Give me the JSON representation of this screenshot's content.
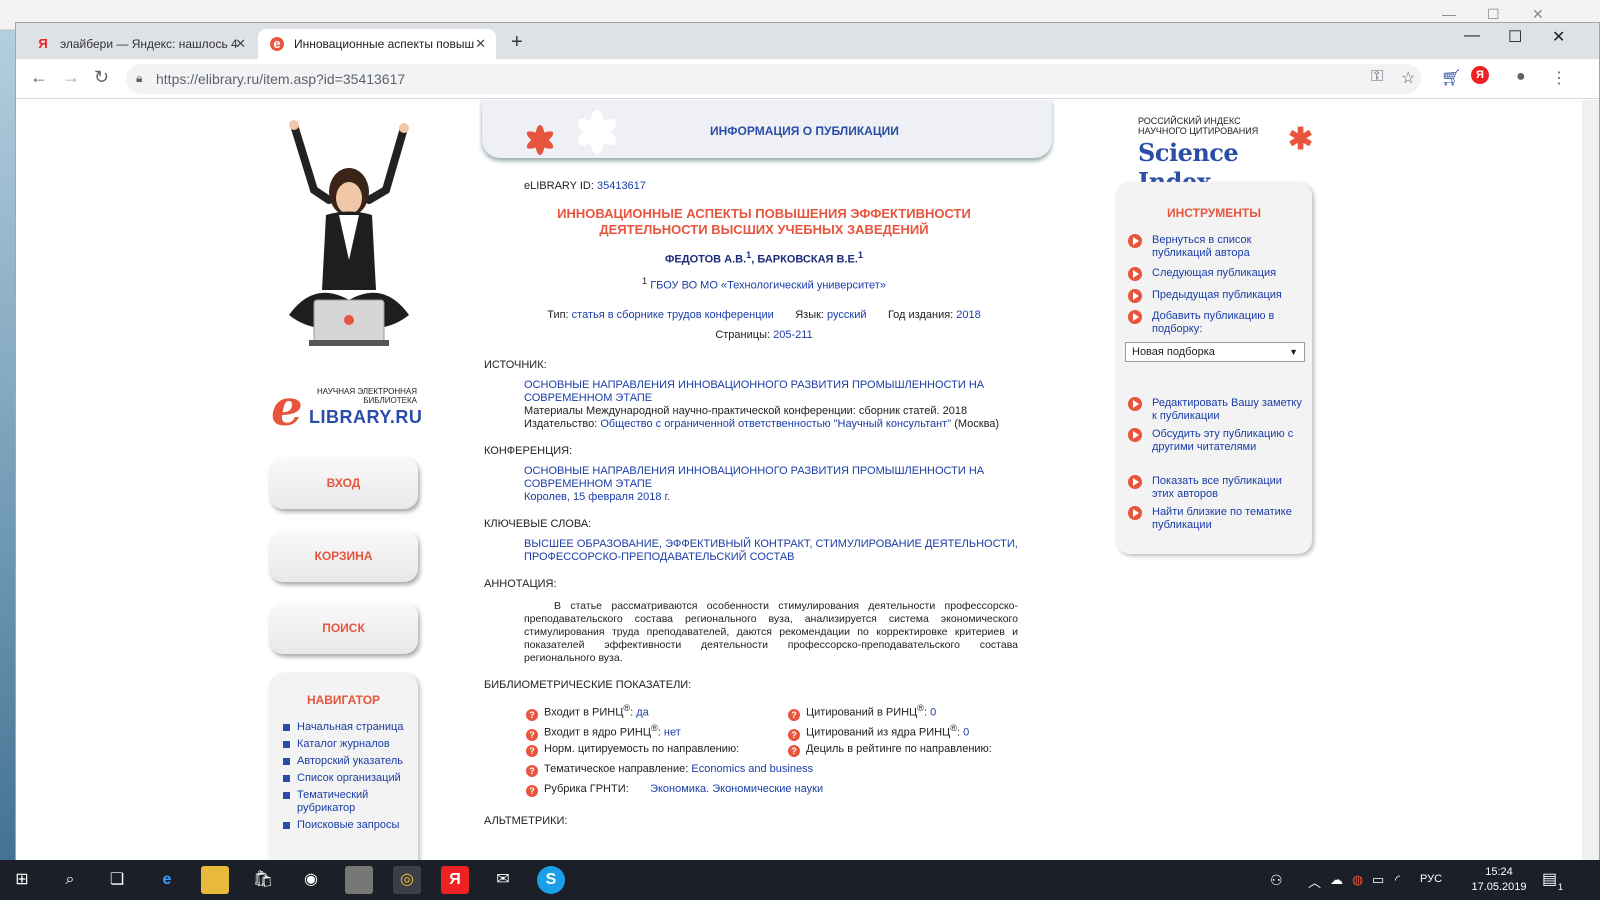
{
  "browser": {
    "tabs": [
      {
        "label": "элайбери — Яндекс: нашлось 4",
        "favicon": "Я",
        "active": false
      },
      {
        "label": "Инновационные аспекты повыш",
        "favicon": "e",
        "active": true
      }
    ],
    "url": "https://elibrary.ru/item.asp?id=35413617",
    "yandex_badge": "Я"
  },
  "header": {
    "title": "ИНФОРМАЦИЯ О ПУБЛИКАЦИИ"
  },
  "logo": {
    "line1": "НАУЧНАЯ ЭЛЕКТРОННАЯ",
    "line2": "БИБЛИОТЕКА",
    "brand": "LIBRARY.RU",
    "brand_letter": "e"
  },
  "left_nav": {
    "buttons": [
      "ВХОД",
      "КОРЗИНА",
      "ПОИСК"
    ],
    "navigator_title": "НАВИГАТОР",
    "navigator_items": [
      "Начальная страница",
      "Каталог журналов",
      "Авторский указатель",
      "Список организаций",
      "Тематический рубрикатор",
      "Поисковые запросы"
    ]
  },
  "publication": {
    "id_label": "eLIBRARY ID:",
    "id": "35413617",
    "title_line1": "ИННОВАЦИОННЫЕ АСПЕКТЫ ПОВЫШЕНИЯ ЭФФЕКТИВНОСТИ",
    "title_line2": "ДЕЯТЕЛЬНОСТИ ВЫСШИХ УЧЕБНЫХ ЗАВЕДЕНИЙ",
    "author1": "ФЕДОТОВ А.В.",
    "author2": "БАРКОВСКАЯ В.Е.",
    "author_sup": "1",
    "affiliation": "ГБОУ ВО МО «Технологический университет»",
    "type_label": "Тип:",
    "type": "статья в сборнике трудов конференции",
    "lang_label": "Язык:",
    "lang": "русский",
    "year_label": "Год издания:",
    "year": "2018",
    "pages_label": "Страницы:",
    "pages": "205-211",
    "source_label": "ИСТОЧНИК:",
    "source_title": "ОСНОВНЫЕ НАПРАВЛЕНИЯ ИННОВАЦИОННОГО РАЗВИТИЯ ПРОМЫШЛЕННОСТИ НА СОВРЕМЕННОМ ЭТАПЕ",
    "source_desc": "Материалы Международной научно-практической конференции: сборник статей. 2018",
    "publisher_label": "Издательство:",
    "publisher": "Общество с ограниченной ответственностью \"Научный консультант\"",
    "publisher_city": "(Москва)",
    "conf_label": "КОНФЕРЕНЦИЯ:",
    "conf_title": "ОСНОВНЫЕ НАПРАВЛЕНИЯ ИННОВАЦИОННОГО РАЗВИТИЯ ПРОМЫШЛЕННОСТИ НА СОВРЕМЕННОМ ЭТАПЕ",
    "conf_place": "Королев, 15 февраля 2018 г.",
    "kw_label": "КЛЮЧЕВЫЕ СЛОВА:",
    "keywords": "ВЫСШЕЕ ОБРАЗОВАНИЕ, ЭФФЕКТИВНЫЙ КОНТРАКТ, СТИМУЛИРОВАНИЕ ДЕЯТЕЛЬНОСТИ, ПРОФЕССОРСКО-ПРЕПОДАВАТЕЛЬСКИЙ СОСТАВ",
    "abs_label": "АННОТАЦИЯ:",
    "abstract": "В статье рассматриваются особенности стимулирования деятельности профессорско-преподавательского состава регионального вуза, анализируется система экономического стимулирования труда преподавателей, даются рекомендации по корректировке критериев и показателей эффективности деятельности профессорско-преподавательского состава регионального вуза.",
    "biblio_label": "БИБЛИОМЕТРИЧЕСКИЕ ПОКАЗАТЕЛИ:",
    "rinc_label": "Входит в РИНЦ",
    "rinc_val": "да",
    "core_label": "Входит в ядро РИНЦ",
    "core_val": "нет",
    "cit_label": "Цитирований в РИНЦ",
    "cit_val": "0",
    "cit_core_label": "Цитирований из ядра РИНЦ",
    "cit_core_val": "0",
    "norm_label": "Норм. цитируемость по направлению:",
    "decile_label": "Дециль в рейтинге по направлению:",
    "topic_label": "Тематическое направление:",
    "topic": "Economics and business",
    "grnti_label": "Рубрика ГРНТИ:",
    "grnti": "Экономика. Экономические науки",
    "alt_label": "АЛЬТМЕТРИКИ:",
    "reg": "®"
  },
  "science_index": {
    "line1": "РОССИЙСКИЙ ИНДЕКС",
    "line2": "НАУЧНОГО ЦИТИРОВАНИЯ",
    "brand": "Science Index"
  },
  "tools": {
    "title": "ИНСТРУМЕНТЫ",
    "items": [
      "Вернуться в список публикаций автора",
      "Следующая публикация",
      "Предыдущая публикация",
      "Добавить публикацию в подборку:",
      "Редактировать Вашу заметку к публикации",
      "Обсудить эту публикацию с другими читателями",
      "Показать все публикации этих авторов",
      "Найти близкие по тематике публикации"
    ],
    "select_value": "Новая подборка"
  },
  "taskbar": {
    "lang": "РУС",
    "time": "15:24",
    "date": "17.05.2019",
    "notif": "1"
  },
  "colors": {
    "accent": "#e8553e",
    "link": "#1a3da8",
    "brand_blue": "#2a4da8"
  }
}
